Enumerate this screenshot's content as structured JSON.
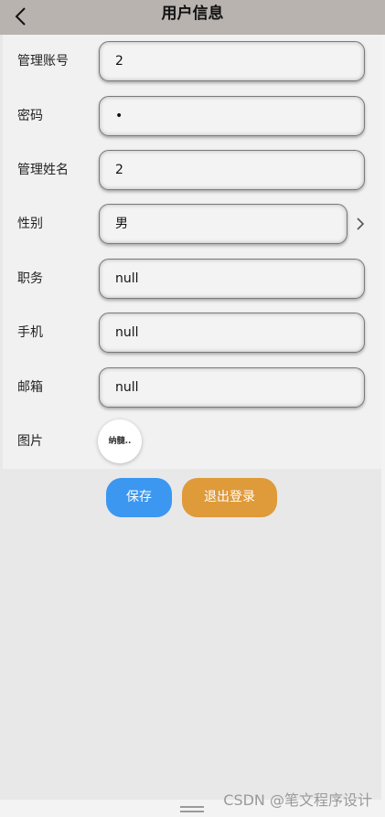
{
  "header": {
    "title": "用户信息",
    "back_icon": "chevron-left-icon"
  },
  "form": {
    "fields": [
      {
        "label": "管理账号",
        "value": "2"
      },
      {
        "label": "密码",
        "value": "•"
      },
      {
        "label": "管理姓名",
        "value": "2"
      },
      {
        "label": "性别",
        "value": "男"
      },
      {
        "label": "职务",
        "value": "null"
      },
      {
        "label": "手机",
        "value": "null"
      },
      {
        "label": "邮箱",
        "value": "null"
      }
    ],
    "image": {
      "label": "图片",
      "avatar_text": "纳髓.."
    }
  },
  "actions": {
    "save_label": "保存",
    "logout_label": "退出登录",
    "save_color": "#3b97f0",
    "logout_color": "#df9a3a"
  },
  "watermark": "CSDN @笔文程序设计"
}
